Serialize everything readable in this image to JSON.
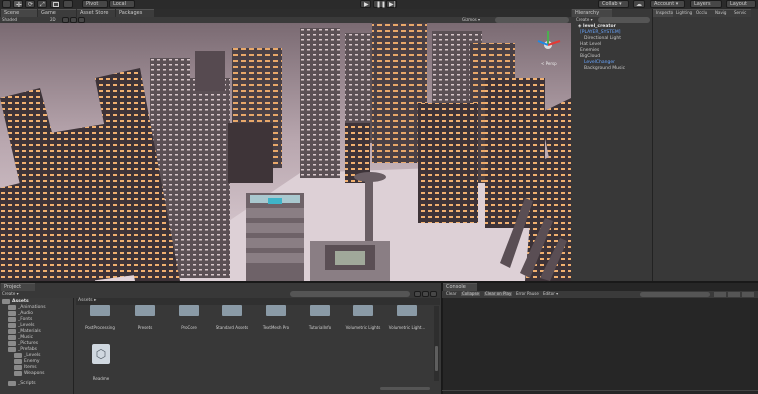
{
  "toolbar": {
    "pivot_label": "Pivot",
    "local_label": "Local",
    "collab_label": "Collab ▾",
    "account_label": "Account ▾",
    "layers_label": "Layers",
    "layout_label": "Layout"
  },
  "scene_tabs": {
    "scene": "Scene",
    "game": "Game",
    "asset_store": "Asset Store",
    "packages": "Packages"
  },
  "scene_toolbar": {
    "shading": "Shaded",
    "mode_2d": "2D",
    "gizmos": "Gizmos ▾",
    "persp": "< Persp"
  },
  "hierarchy": {
    "title": "Hierarchy",
    "create": "Create ▾",
    "scene_name": "level_creator",
    "items": [
      "[PLAYER_SYSTEM]",
      "Directional Light",
      "Hat Level",
      "Enemies",
      "BigCloud",
      "LevelChanger",
      "Background Music"
    ]
  },
  "inspector": {
    "tabs": [
      "Inspector",
      "Lighting",
      "Occlu",
      "Navig",
      "Servic"
    ]
  },
  "project": {
    "title": "Project",
    "create": "Create ▾",
    "tree": [
      "Assets",
      "_Animations",
      "_Audio",
      "_Fonts",
      "_Levels",
      "_Materials",
      "_Music",
      "_Pictures",
      "_Prefabs",
      "_Levels",
      "Enemy",
      "Items",
      "Weapons",
      "_Scripts"
    ],
    "breadcrumb": "Assets ▸",
    "assets": [
      "PostProcessing",
      "Presets",
      "ProCore",
      "Standard Assets",
      "TextMesh Pro",
      "TutorialInfo",
      "Volumetric Lights",
      "Volumetric Light...",
      "Readme"
    ]
  },
  "console": {
    "title": "Console",
    "buttons": [
      "Clear",
      "Collapse",
      "Clear on Play",
      "Error Pause",
      "Editor ▾"
    ]
  },
  "colors": {
    "scene_bg": "#d9c8d0",
    "panel": "#383838",
    "accent": "#4a7fc4"
  }
}
